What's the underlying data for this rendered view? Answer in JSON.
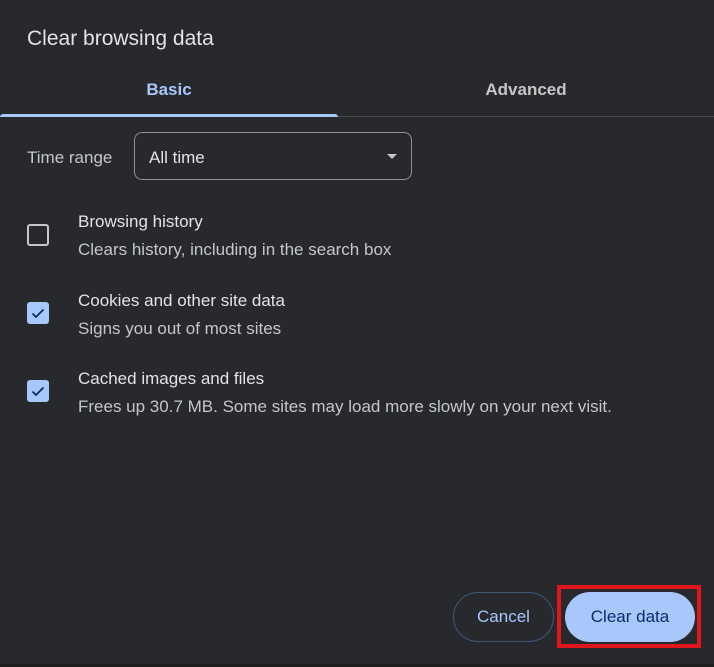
{
  "dialog": {
    "title": "Clear browsing data"
  },
  "tabs": [
    {
      "label": "Basic",
      "selected": true
    },
    {
      "label": "Advanced",
      "selected": false
    }
  ],
  "time_range": {
    "label": "Time range",
    "selected_value": "All time"
  },
  "options": [
    {
      "title": "Browsing history",
      "description": "Clears history, including in the search box",
      "checked": false
    },
    {
      "title": "Cookies and other site data",
      "description": "Signs you out of most sites",
      "checked": true
    },
    {
      "title": "Cached images and files",
      "description": "Frees up 30.7 MB. Some sites may load more slowly on your next visit.",
      "checked": true
    }
  ],
  "buttons": {
    "cancel_label": "Cancel",
    "clear_label": "Clear data"
  },
  "colors": {
    "background": "#28292d",
    "accent": "#a8c7fa",
    "highlight": "#e0161c"
  },
  "icons": {
    "checkmark": "check-icon",
    "dropdown": "triangle-down-icon"
  }
}
